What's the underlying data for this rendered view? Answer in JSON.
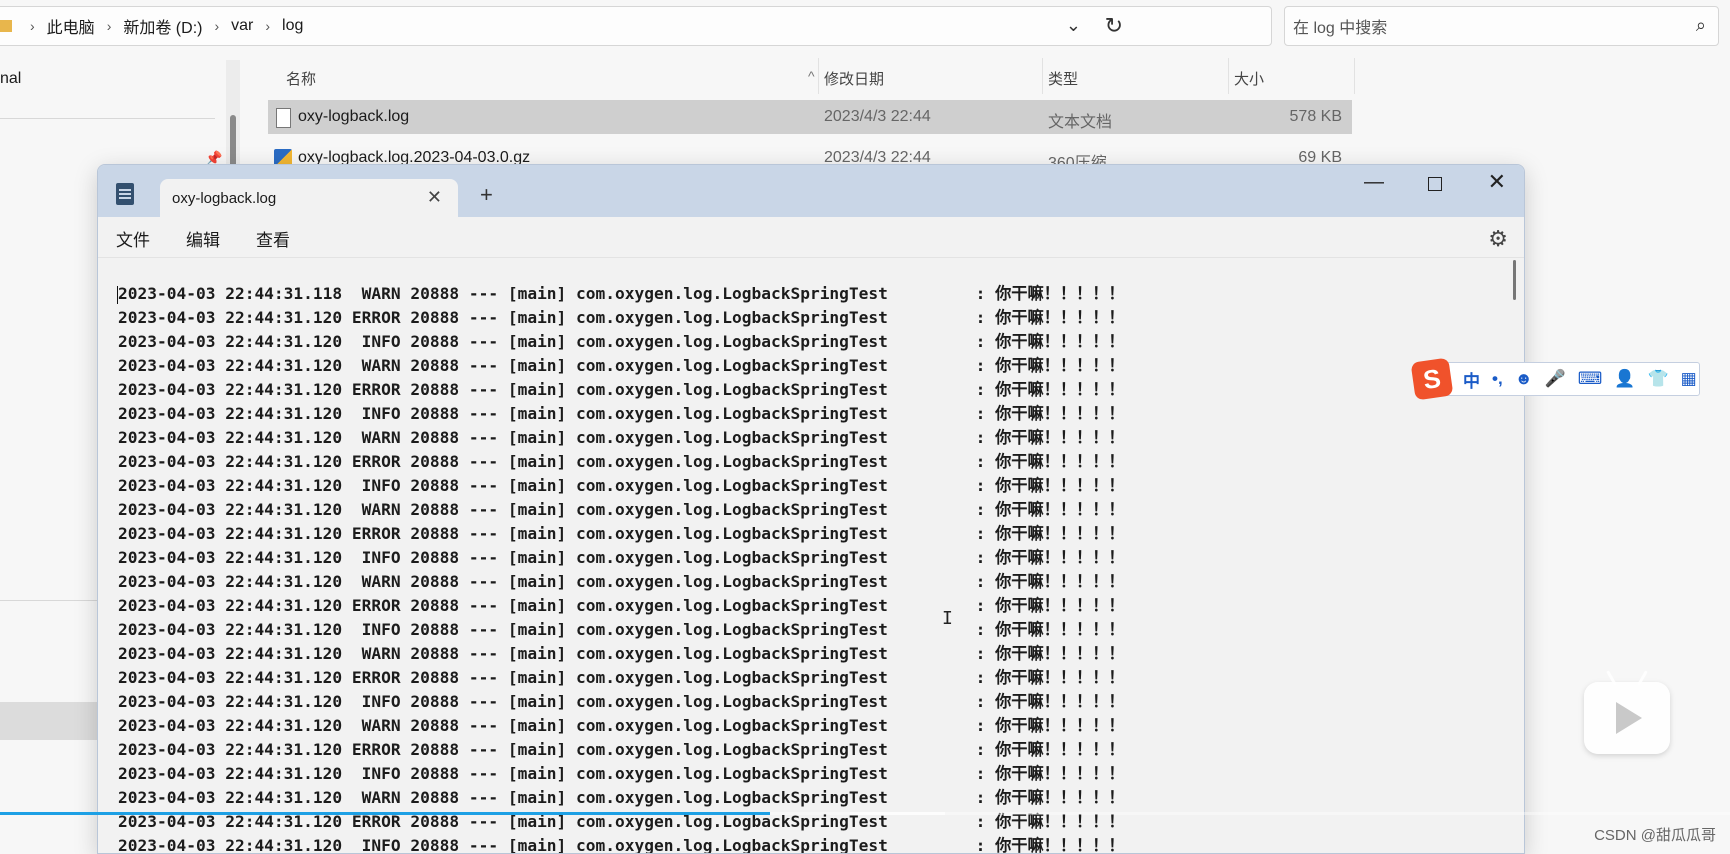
{
  "explorer": {
    "breadcrumb": [
      "此电脑",
      "新加卷 (D:)",
      "var",
      "log"
    ],
    "search_placeholder": "在 log 中搜索",
    "nav_item": "nal",
    "columns": {
      "name": "名称",
      "modified": "修改日期",
      "type": "类型",
      "size": "大小"
    },
    "files": [
      {
        "name": "oxy-logback.log",
        "modified": "2023/4/3 22:44",
        "type": "文本文档",
        "size": "578 KB"
      },
      {
        "name": "oxy-logback.log.2023-04-03.0.gz",
        "modified": "2023/4/3 22:44",
        "type": "360压缩",
        "size": "69 KB"
      }
    ]
  },
  "notepad": {
    "tab_title": "oxy-logback.log",
    "new_tab": "+",
    "menu": {
      "file": "文件",
      "edit": "编辑",
      "view": "查看"
    },
    "lines": [
      "2023-04-03 22:44:31.118  WARN 20888 --- [main] com.oxygen.log.LogbackSpringTest         : 你干嘛！！！！！",
      "2023-04-03 22:44:31.120 ERROR 20888 --- [main] com.oxygen.log.LogbackSpringTest         : 你干嘛！！！！！",
      "2023-04-03 22:44:31.120  INFO 20888 --- [main] com.oxygen.log.LogbackSpringTest         : 你干嘛！！！！！",
      "2023-04-03 22:44:31.120  WARN 20888 --- [main] com.oxygen.log.LogbackSpringTest         : 你干嘛！！！！！",
      "2023-04-03 22:44:31.120 ERROR 20888 --- [main] com.oxygen.log.LogbackSpringTest         : 你干嘛！！！！！",
      "2023-04-03 22:44:31.120  INFO 20888 --- [main] com.oxygen.log.LogbackSpringTest         : 你干嘛！！！！！",
      "2023-04-03 22:44:31.120  WARN 20888 --- [main] com.oxygen.log.LogbackSpringTest         : 你干嘛！！！！！",
      "2023-04-03 22:44:31.120 ERROR 20888 --- [main] com.oxygen.log.LogbackSpringTest         : 你干嘛！！！！！",
      "2023-04-03 22:44:31.120  INFO 20888 --- [main] com.oxygen.log.LogbackSpringTest         : 你干嘛！！！！！",
      "2023-04-03 22:44:31.120  WARN 20888 --- [main] com.oxygen.log.LogbackSpringTest         : 你干嘛！！！！！",
      "2023-04-03 22:44:31.120 ERROR 20888 --- [main] com.oxygen.log.LogbackSpringTest         : 你干嘛！！！！！",
      "2023-04-03 22:44:31.120  INFO 20888 --- [main] com.oxygen.log.LogbackSpringTest         : 你干嘛！！！！！",
      "2023-04-03 22:44:31.120  WARN 20888 --- [main] com.oxygen.log.LogbackSpringTest         : 你干嘛！！！！！",
      "2023-04-03 22:44:31.120 ERROR 20888 --- [main] com.oxygen.log.LogbackSpringTest         : 你干嘛！！！！！",
      "2023-04-03 22:44:31.120  INFO 20888 --- [main] com.oxygen.log.LogbackSpringTest         : 你干嘛！！！！！",
      "2023-04-03 22:44:31.120  WARN 20888 --- [main] com.oxygen.log.LogbackSpringTest         : 你干嘛！！！！！",
      "2023-04-03 22:44:31.120 ERROR 20888 --- [main] com.oxygen.log.LogbackSpringTest         : 你干嘛！！！！！",
      "2023-04-03 22:44:31.120  INFO 20888 --- [main] com.oxygen.log.LogbackSpringTest         : 你干嘛！！！！！",
      "2023-04-03 22:44:31.120  WARN 20888 --- [main] com.oxygen.log.LogbackSpringTest         : 你干嘛！！！！！",
      "2023-04-03 22:44:31.120 ERROR 20888 --- [main] com.oxygen.log.LogbackSpringTest         : 你干嘛！！！！！",
      "2023-04-03 22:44:31.120  INFO 20888 --- [main] com.oxygen.log.LogbackSpringTest         : 你干嘛！！！！！",
      "2023-04-03 22:44:31.120  WARN 20888 --- [main] com.oxygen.log.LogbackSpringTest         : 你干嘛！！！！！",
      "2023-04-03 22:44:31.120 ERROR 20888 --- [main] com.oxygen.log.LogbackSpringTest         : 你干嘛！！！！！",
      "2023-04-03 22:44:31.120  INFO 20888 --- [main] com.oxygen.log.LogbackSpringTest         : 你干嘛！！！！！"
    ]
  },
  "ime": {
    "logo": "S",
    "mode": "中",
    "punct": "•,",
    "emoji": "☻",
    "mic": "🎤",
    "keyboard": "⌨",
    "user": "👤",
    "skin": "👕",
    "apps": "▦"
  },
  "video": {
    "progress": 0.445,
    "watermark": "CSDN @甜瓜瓜哥"
  }
}
